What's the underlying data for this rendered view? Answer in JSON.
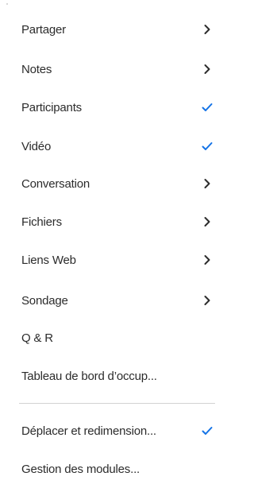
{
  "colors": {
    "text": "#2c2c2c",
    "check": "#1473e6",
    "chevron": "#2c2c2c",
    "divider": "#d2d2d2"
  },
  "menu": {
    "items": [
      {
        "label": "Partager",
        "icon": "chevron-right-icon"
      },
      {
        "label": "Notes",
        "icon": "chevron-right-icon"
      },
      {
        "label": "Participants",
        "icon": "checkmark-icon"
      },
      {
        "label": "Vidéo",
        "icon": "checkmark-icon"
      },
      {
        "label": "Conversation",
        "icon": "chevron-right-icon"
      },
      {
        "label": "Fichiers",
        "icon": "chevron-right-icon"
      },
      {
        "label": "Liens Web",
        "icon": "chevron-right-icon"
      },
      {
        "label": "Sondage",
        "icon": "chevron-right-icon"
      },
      {
        "label": "Q & R",
        "icon": ""
      },
      {
        "label": "Tableau de bord d’occup...",
        "icon": ""
      }
    ],
    "secondary_items": [
      {
        "label": "Déplacer et redimension...",
        "icon": "checkmark-icon"
      },
      {
        "label": "Gestion des modules...",
        "icon": ""
      }
    ]
  }
}
